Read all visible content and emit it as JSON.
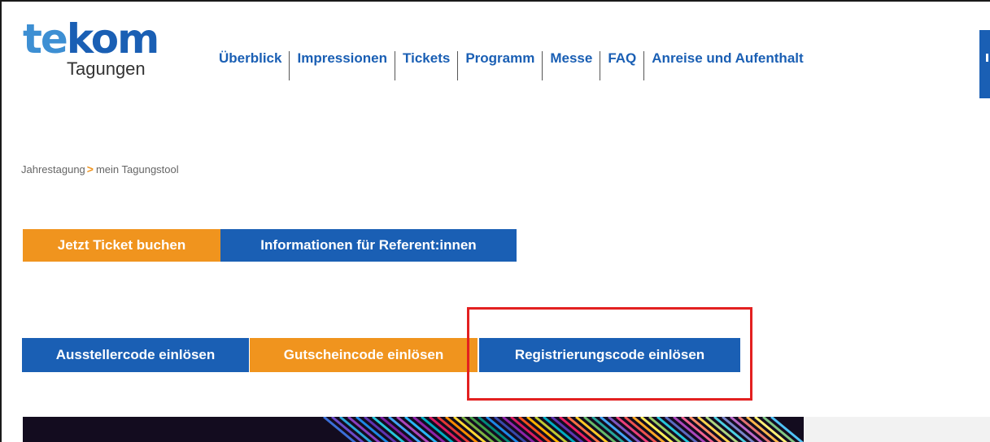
{
  "logo": {
    "main_part1": "te",
    "main_part2": "kom",
    "sub": "Tagungen"
  },
  "nav": {
    "items": [
      {
        "label": "Überblick"
      },
      {
        "label": "Impressionen"
      },
      {
        "label": "Tickets"
      },
      {
        "label": "Programm"
      },
      {
        "label": "Messe"
      },
      {
        "label": "FAQ"
      },
      {
        "label": "Anreise und Aufenthalt"
      }
    ]
  },
  "breadcrumb": {
    "parent": "Jahrestagung",
    "separator": ">",
    "current": "mein Tagungstool"
  },
  "buttons": {
    "ticket": "Jetzt Ticket buchen",
    "referenten": "Informationen für Referent:innen",
    "aussteller": "Ausstellercode einlösen",
    "gutschein": "Gutscheincode einlösen",
    "registrierung": "Registrierungscode einlösen"
  },
  "colors": {
    "brand_blue": "#1a5fb4",
    "logo_light_blue": "#3d8fd3",
    "accent_orange": "#f0941e",
    "highlight_red": "#e32020"
  }
}
